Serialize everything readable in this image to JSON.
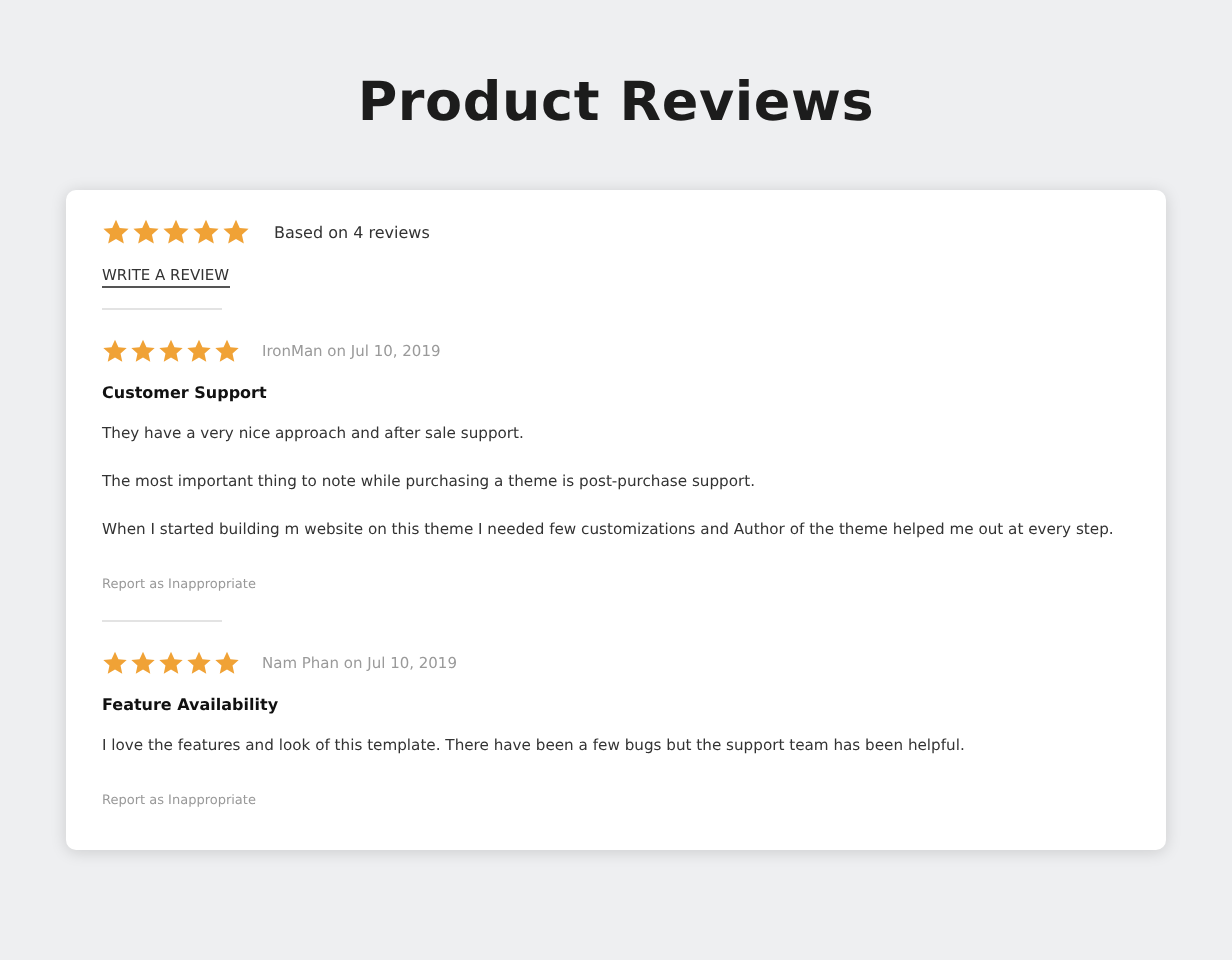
{
  "title": "Product Reviews",
  "summary": {
    "stars": 5,
    "text": "Based on 4 reviews",
    "link": "WRITE A REVIEW"
  },
  "reviews": [
    {
      "stars": 5,
      "byline": "IronMan on Jul 10, 2019",
      "heading": "Customer Support",
      "paragraphs": [
        "They have a very nice approach and after sale support.",
        "The most important thing to note while purchasing a theme is post-purchase support.",
        "When I started building m website on this theme I needed few customizations and Author of the theme helped me out at every step."
      ],
      "report": "Report as Inappropriate"
    },
    {
      "stars": 5,
      "byline": "Nam Phan on Jul 10, 2019",
      "heading": "Feature Availability",
      "paragraphs": [
        "I love the features and look of this template. There have been a few bugs but the support team has been helpful."
      ],
      "report": "Report as Inappropriate"
    }
  ]
}
